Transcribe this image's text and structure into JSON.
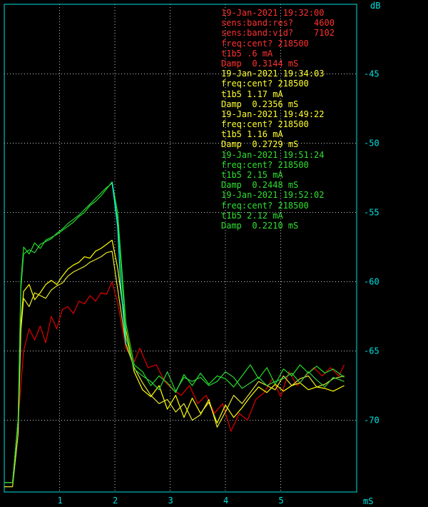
{
  "colors": {
    "background": "#000000",
    "frame": "#00e0e0",
    "grid": "#c8c8c8",
    "axis_text": "#00e0e0",
    "red": "#e00000",
    "yellow": "#ffff00",
    "yellow2": "#e8e830",
    "green": "#20e020",
    "green2": "#30d040",
    "cyan": "#00ffff"
  },
  "annotations": [
    {
      "color": "#ff3030",
      "lines": [
        "19-Jan-2021 19:32:00",
        "sens:band:res?    4600",
        "sens:band:vid?    7102",
        "freq:cent? 218500",
        "t1b5 .6 mA",
        "Damp  0.3144 mS"
      ]
    },
    {
      "color": "#ffff30",
      "lines": [
        "19-Jan-2021 19:34:03",
        "freq:cent? 218500",
        "t1b5 1.17 mA",
        "Damp  0.2356 mS"
      ]
    },
    {
      "color": "#ffff30",
      "lines": [
        "19-Jan-2021 19:49:22",
        "freq:cent? 218500",
        "t1b5 1.16 mA",
        "Damp  0.2729 mS"
      ]
    },
    {
      "color": "#30e030",
      "lines": [
        "19-Jan-2021 19:51:24",
        "freq:cent? 218500",
        "t1b5 2.15 mA",
        "Damp  0.2448 mS"
      ]
    },
    {
      "color": "#30e030",
      "lines": [
        "19-Jan-2021 19:52:02",
        "freq:cent? 218500",
        "t1b5 2.12 mA",
        "Damp  0.2210 mS"
      ]
    }
  ],
  "chart_data": {
    "type": "line",
    "ylabel": "dB",
    "xlabel": "mS",
    "xlim": [
      0,
      6.15
    ],
    "ylim": [
      -75,
      -40
    ],
    "grid": true,
    "x_ticks": [
      1,
      2,
      3,
      4,
      5
    ],
    "y_ticks": [
      -45,
      -50,
      -55,
      -60,
      -65,
      -70
    ],
    "series": [
      {
        "color": "#e00000",
        "x": [
          0.0,
          0.15,
          0.25,
          0.35,
          0.45,
          0.55,
          0.65,
          0.75,
          0.85,
          0.95,
          1.05,
          1.15,
          1.25,
          1.35,
          1.45,
          1.55,
          1.65,
          1.75,
          1.85,
          1.95,
          2.05,
          2.2,
          2.35,
          2.45,
          2.6,
          2.75,
          2.9,
          3.05,
          3.2,
          3.35,
          3.5,
          3.65,
          3.8,
          3.95,
          4.1,
          4.25,
          4.4,
          4.55,
          4.7,
          4.85,
          5.0,
          5.15,
          5.3,
          5.45,
          5.6,
          5.75,
          5.9,
          6.05,
          6.15
        ],
        "y": [
          -74.5,
          -74.5,
          -70.0,
          -65.0,
          -63.4,
          -64.2,
          -63.2,
          -64.4,
          -62.5,
          -63.4,
          -62.0,
          -61.8,
          -62.3,
          -61.4,
          -61.6,
          -61.0,
          -61.4,
          -60.8,
          -60.9,
          -60.0,
          -61.5,
          -64.8,
          -65.8,
          -64.8,
          -66.2,
          -66.0,
          -67.2,
          -67.8,
          -68.2,
          -67.5,
          -68.8,
          -68.2,
          -69.5,
          -68.8,
          -70.8,
          -69.5,
          -70.0,
          -68.5,
          -68.0,
          -67.0,
          -68.3,
          -66.5,
          -67.5,
          -66.8,
          -66.2,
          -66.8,
          -66.2,
          -66.8,
          -66.0
        ]
      },
      {
        "color": "#ffff00",
        "x": [
          0.0,
          0.15,
          0.25,
          0.3,
          0.35,
          0.45,
          0.55,
          0.65,
          0.75,
          0.85,
          0.95,
          1.05,
          1.15,
          1.25,
          1.35,
          1.45,
          1.55,
          1.65,
          1.75,
          1.85,
          1.95,
          2.05,
          2.2,
          2.35,
          2.5,
          2.65,
          2.8,
          2.95,
          3.1,
          3.25,
          3.4,
          3.55,
          3.7,
          3.85,
          4.0,
          4.15,
          4.3,
          4.45,
          4.6,
          4.75,
          4.9,
          5.05,
          5.2,
          5.35,
          5.5,
          5.65,
          5.8,
          5.95,
          6.15
        ],
        "y": [
          -74.5,
          -74.5,
          -70.0,
          -63.0,
          -60.7,
          -60.2,
          -61.3,
          -60.8,
          -60.2,
          -59.9,
          -60.2,
          -59.6,
          -59.1,
          -58.8,
          -58.6,
          -58.2,
          -58.3,
          -57.8,
          -57.6,
          -57.3,
          -57.0,
          -59.0,
          -63.5,
          -66.5,
          -67.8,
          -68.3,
          -67.5,
          -69.2,
          -68.2,
          -69.8,
          -68.4,
          -69.5,
          -68.7,
          -70.2,
          -68.9,
          -69.8,
          -69.1,
          -68.3,
          -67.6,
          -68.0,
          -67.4,
          -67.9,
          -67.5,
          -67.3,
          -67.8,
          -67.6,
          -67.7,
          -67.9,
          -67.5
        ]
      },
      {
        "color": "#e8e830",
        "x": [
          0.0,
          0.15,
          0.25,
          0.3,
          0.35,
          0.45,
          0.55,
          0.65,
          0.75,
          0.85,
          0.95,
          1.05,
          1.15,
          1.25,
          1.35,
          1.45,
          1.55,
          1.65,
          1.75,
          1.85,
          1.95,
          2.05,
          2.2,
          2.35,
          2.5,
          2.65,
          2.8,
          2.95,
          3.1,
          3.25,
          3.4,
          3.55,
          3.7,
          3.85,
          4.0,
          4.15,
          4.3,
          4.45,
          4.6,
          4.75,
          4.9,
          5.05,
          5.2,
          5.35,
          5.5,
          5.65,
          5.8,
          5.95,
          6.15
        ],
        "y": [
          -74.8,
          -74.8,
          -71.0,
          -63.5,
          -61.2,
          -61.8,
          -60.8,
          -61.0,
          -61.2,
          -60.6,
          -60.3,
          -60.1,
          -59.6,
          -59.3,
          -59.1,
          -58.9,
          -58.6,
          -58.4,
          -58.2,
          -57.9,
          -57.8,
          -60.5,
          -64.5,
          -66.2,
          -67.3,
          -68.2,
          -68.8,
          -68.5,
          -69.4,
          -68.8,
          -70.0,
          -69.6,
          -68.5,
          -70.5,
          -69.4,
          -68.2,
          -68.8,
          -68.0,
          -67.2,
          -67.5,
          -67.8,
          -66.8,
          -67.5,
          -67.0,
          -66.8,
          -67.6,
          -67.4,
          -67.0,
          -66.8
        ]
      },
      {
        "color": "#20e020",
        "x": [
          0.0,
          0.15,
          0.25,
          0.3,
          0.35,
          0.45,
          0.55,
          0.65,
          0.75,
          0.85,
          0.95,
          1.05,
          1.15,
          1.25,
          1.35,
          1.45,
          1.55,
          1.65,
          1.75,
          1.85,
          1.95,
          2.05,
          2.2,
          2.35,
          2.5,
          2.65,
          2.8,
          2.95,
          3.1,
          3.25,
          3.4,
          3.55,
          3.7,
          3.85,
          4.0,
          4.15,
          4.3,
          4.45,
          4.6,
          4.75,
          4.9,
          5.05,
          5.2,
          5.35,
          5.5,
          5.65,
          5.8,
          5.95,
          6.15
        ],
        "y": [
          -74.5,
          -74.5,
          -70.0,
          -60.0,
          -57.5,
          -58.0,
          -57.2,
          -57.6,
          -57.0,
          -56.8,
          -56.6,
          -56.3,
          -56.0,
          -55.7,
          -55.3,
          -55.0,
          -54.5,
          -54.2,
          -53.8,
          -53.3,
          -52.8,
          -55.0,
          -63.0,
          -66.0,
          -66.5,
          -67.5,
          -66.8,
          -67.3,
          -68.0,
          -66.7,
          -67.5,
          -66.6,
          -67.4,
          -66.8,
          -67.0,
          -67.6,
          -66.8,
          -66.0,
          -67.0,
          -66.2,
          -67.4,
          -66.3,
          -66.8,
          -66.0,
          -66.6,
          -66.1,
          -66.6,
          -66.3,
          -66.9
        ]
      },
      {
        "color": "#30d040",
        "x": [
          0.0,
          0.15,
          0.25,
          0.3,
          0.35,
          0.45,
          0.55,
          0.65,
          0.75,
          0.85,
          0.95,
          1.05,
          1.15,
          1.25,
          1.35,
          1.45,
          1.55,
          1.65,
          1.75,
          1.85,
          1.95,
          2.05,
          2.2,
          2.35,
          2.5,
          2.65,
          2.8,
          2.95,
          3.1,
          3.25,
          3.4,
          3.55,
          3.7,
          3.85,
          4.0,
          4.15,
          4.3,
          4.45,
          4.6,
          4.75,
          4.9,
          5.05,
          5.2,
          5.35,
          5.5,
          5.65,
          5.8,
          5.95,
          6.15
        ],
        "y": [
          -74.5,
          -74.5,
          -70.0,
          -60.5,
          -58.0,
          -57.7,
          -57.9,
          -57.3,
          -57.1,
          -56.9,
          -56.5,
          -56.2,
          -55.8,
          -55.5,
          -55.2,
          -54.8,
          -54.4,
          -54.0,
          -53.6,
          -53.2,
          -52.9,
          -55.5,
          -64.0,
          -66.3,
          -66.8,
          -67.2,
          -67.8,
          -66.5,
          -67.9,
          -66.9,
          -67.2,
          -66.9,
          -67.5,
          -67.2,
          -66.5,
          -66.9,
          -67.7,
          -67.3,
          -66.9,
          -67.5,
          -67.2,
          -67.0,
          -66.6,
          -67.3,
          -66.5,
          -67.1,
          -67.6,
          -66.9,
          -67.2
        ]
      },
      {
        "color": "#00ffff",
        "x": [
          1.95,
          2.05,
          2.1,
          2.2
        ],
        "y": [
          -52.8,
          -56.0,
          -60.0,
          -64.5
        ]
      }
    ]
  }
}
